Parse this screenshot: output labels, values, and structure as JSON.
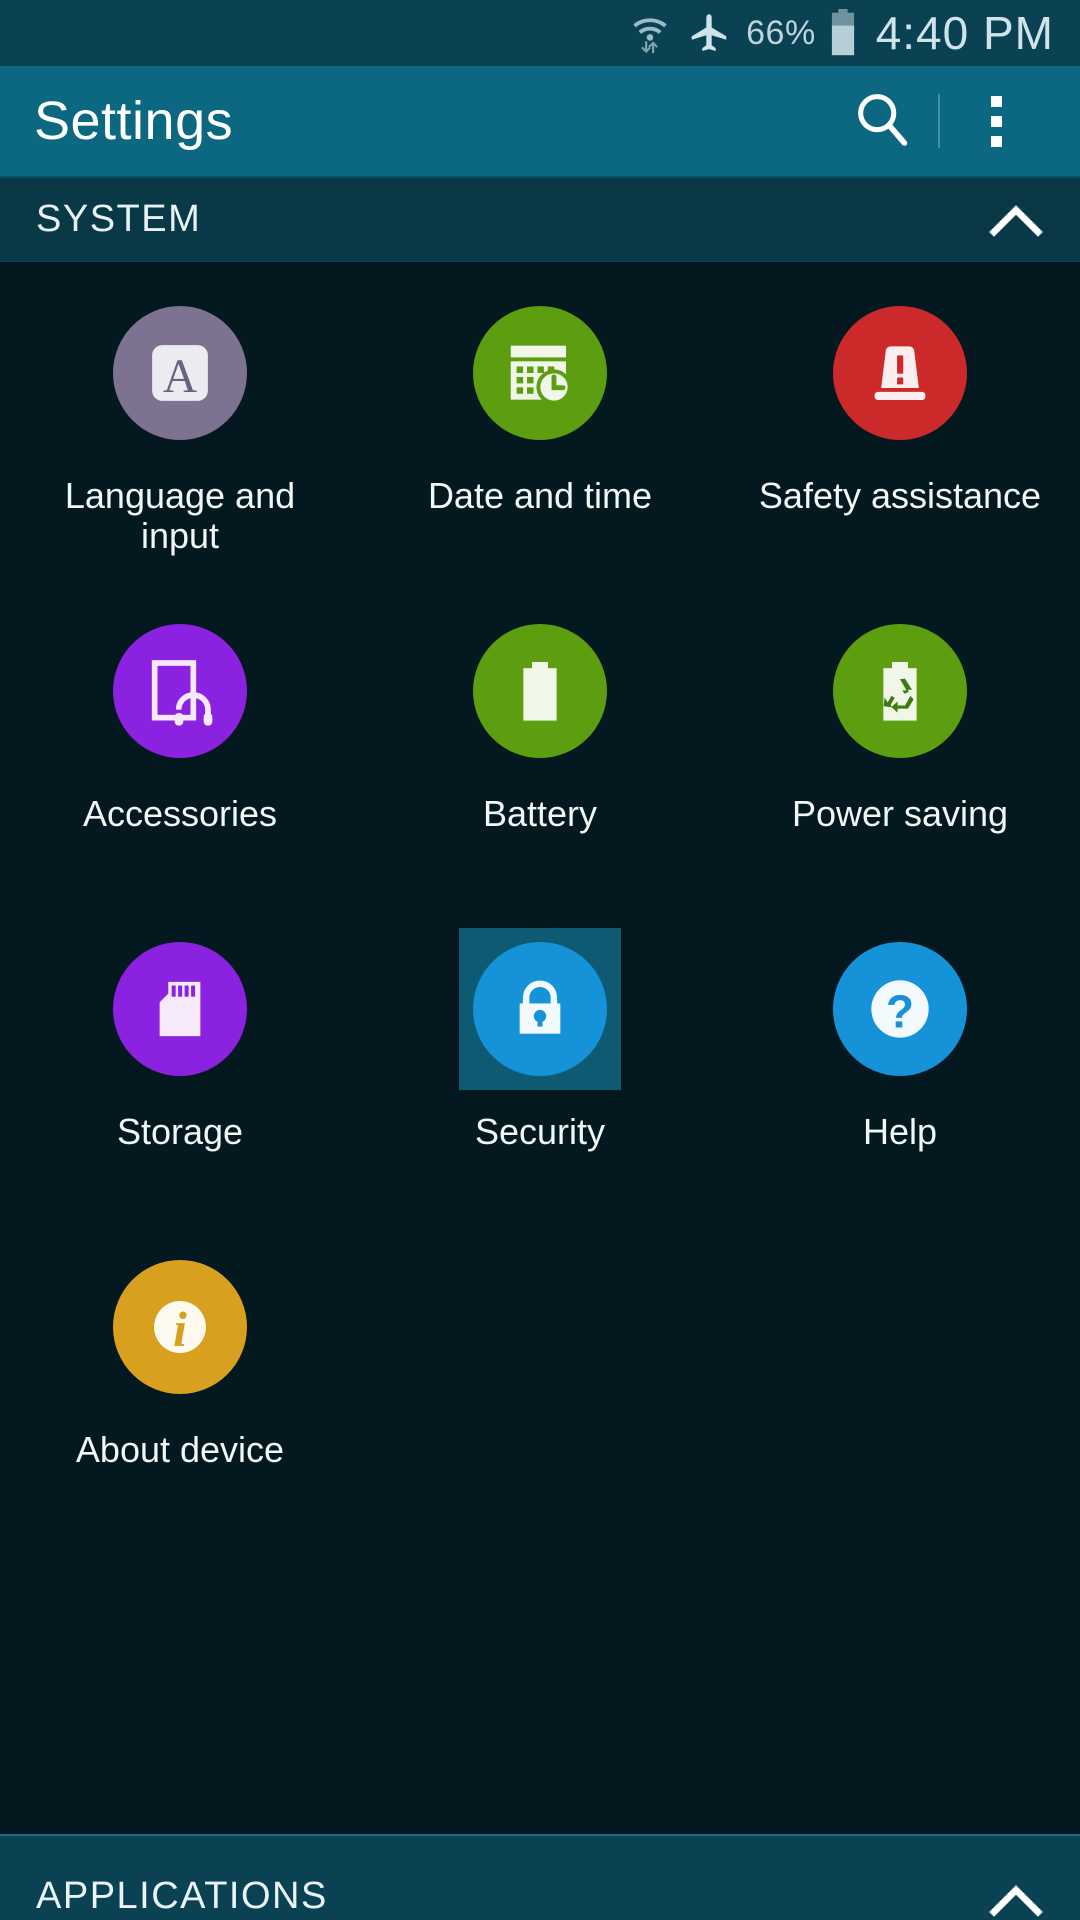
{
  "status_bar": {
    "wifi_icon": "wifi-with-transfer-arrows-icon",
    "airplane_icon": "airplane-mode-icon",
    "battery_percent": "66%",
    "battery_icon": "battery-icon",
    "time": "4:40 PM"
  },
  "action_bar": {
    "title": "Settings",
    "search_icon": "search-icon",
    "overflow_icon": "more-options-icon"
  },
  "sections": {
    "system": {
      "title": "SYSTEM",
      "collapse_icon": "chevron-up-icon"
    },
    "applications": {
      "title": "APPLICATIONS",
      "collapse_icon": "chevron-up-icon"
    }
  },
  "colors": {
    "status_bar_bg": "#0a4253",
    "action_bar_bg": "#0b6880",
    "section_bg": "#093846",
    "page_bg": "#04191f",
    "selection_highlight": "#0e5a73"
  },
  "grid_items": [
    {
      "label": "Language and input",
      "icon": "keyboard-letter-a-icon",
      "color": "#7d7390",
      "selected": false
    },
    {
      "label": "Date and time",
      "icon": "calendar-clock-icon",
      "color": "#5c9e10",
      "selected": false
    },
    {
      "label": "Safety assistance",
      "icon": "emergency-beacon-icon",
      "color": "#cc2a2a",
      "selected": false
    },
    {
      "label": "Accessories",
      "icon": "phone-headphones-icon",
      "color": "#8b22e0",
      "selected": false
    },
    {
      "label": "Battery",
      "icon": "battery-icon",
      "color": "#5c9e10",
      "selected": false
    },
    {
      "label": "Power saving",
      "icon": "battery-recycle-icon",
      "color": "#5c9e10",
      "selected": false
    },
    {
      "label": "Storage",
      "icon": "sd-card-icon",
      "color": "#8b22e0",
      "selected": false
    },
    {
      "label": "Security",
      "icon": "padlock-icon",
      "color": "#1592d8",
      "selected": true
    },
    {
      "label": "Help",
      "icon": "question-mark-icon",
      "color": "#1592d8",
      "selected": false
    },
    {
      "label": "About device",
      "icon": "information-icon",
      "color": "#d8a01e",
      "selected": false
    }
  ]
}
